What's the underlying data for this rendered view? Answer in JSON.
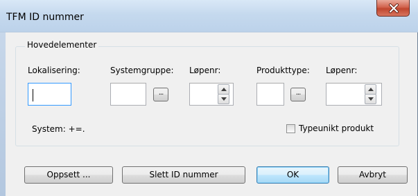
{
  "window": {
    "title": "TFM ID nummer"
  },
  "group": {
    "legend": "Hovedelementer"
  },
  "fields": {
    "lokalisering_label": "Lokalisering:",
    "lokalisering_value": "",
    "systemgruppe_label": "Systemgruppe:",
    "systemgruppe_value": "",
    "system_lopenr_label": "Løpenr:",
    "system_lopenr_value": "",
    "produkttype_label": "Produkttype:",
    "produkttype_value": "",
    "produkt_lopenr_label": "Løpenr:",
    "produkt_lopenr_value": ""
  },
  "browse_label": "...",
  "system_text": "System: +=.",
  "checkbox": {
    "label": "Typeunikt produkt",
    "checked": false
  },
  "buttons": {
    "oppsett": "Oppsett ...",
    "slett": "Slett ID nummer",
    "ok": "OK",
    "avbryt": "Avbryt"
  },
  "colors": {
    "close_button": "#c0462e",
    "focus_border": "#3399ff",
    "default_button_border": "#3c7fb1"
  },
  "icons": {
    "close": "close-icon",
    "spin_up": "arrow-up-icon",
    "spin_down": "arrow-down-icon"
  }
}
